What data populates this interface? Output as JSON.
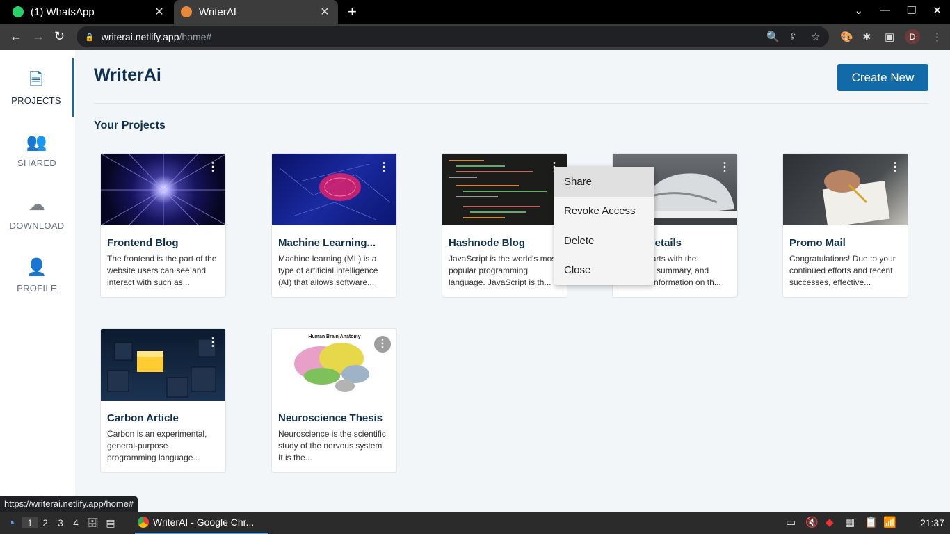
{
  "browser": {
    "tabs": [
      {
        "label": "(1) WhatsApp",
        "favicon_color": "#25d366"
      },
      {
        "label": "WriterAI",
        "favicon_color": "#e8883a"
      }
    ],
    "url_host": "writerai.netlify.app",
    "url_path": "/home#",
    "profile_initial": "D",
    "status_url": "https://writerai.netlify.app/home#"
  },
  "sidebar": {
    "items": [
      {
        "label": "PROJECTS",
        "icon": "file-plus-icon",
        "glyph": "🗋"
      },
      {
        "label": "SHARED",
        "icon": "people-icon",
        "glyph": "👥"
      },
      {
        "label": "DOWNLOAD",
        "icon": "cloud-download-icon",
        "glyph": "☁"
      },
      {
        "label": "PROFILE",
        "icon": "user-circle-icon",
        "glyph": "👤"
      }
    ]
  },
  "header": {
    "brand": "WriterAi",
    "create_label": "Create New",
    "section_title": "Your Projects"
  },
  "projects": [
    {
      "title": "Frontend Blog",
      "desc": "The frontend is the part of the website users can see and interact with such as..."
    },
    {
      "title": "Machine Learning...",
      "desc": "Machine learning (ML) is a type of artificial intelligence (AI) that allows software..."
    },
    {
      "title": "Hashnode Blog",
      "desc": "JavaScript is the world's most popular programming language. JavaScript is th..."
    },
    {
      "title": "Shoe Details",
      "desc": "A brief starts with the executive summary, and includes information on th..."
    },
    {
      "title": "Promo Mail",
      "desc": "Congratulations! Due to your continued efforts and recent successes, effective..."
    },
    {
      "title": "Carbon Article",
      "desc": "Carbon is an experimental, general-purpose programming language..."
    },
    {
      "title": "Neuroscience Thesis",
      "desc": "Neuroscience is the scientific study of the nervous system. It is the..."
    }
  ],
  "thumb_texts": {
    "brain_title": "Human Brain Anatomy"
  },
  "context_menu": {
    "items": [
      "Share",
      "Revoke Access",
      "Delete",
      "Close"
    ]
  },
  "taskbar": {
    "workspaces": [
      "1",
      "2",
      "3",
      "4"
    ],
    "active_window": "WriterAI - Google Chr...",
    "clock": "21:37"
  }
}
